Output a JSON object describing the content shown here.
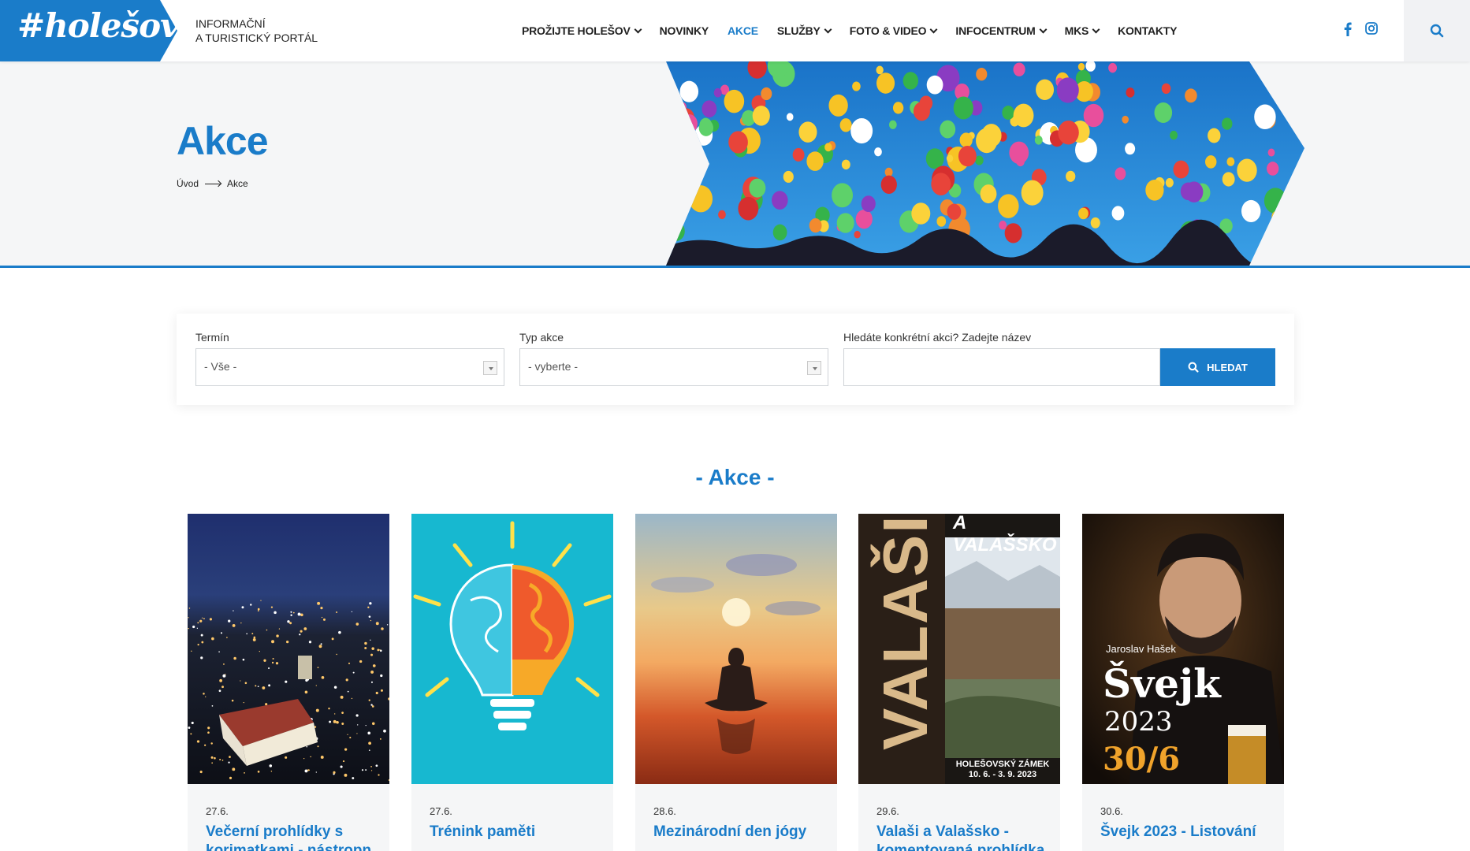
{
  "header": {
    "logo_text": "#holešov",
    "portal_line1": "INFORMAČNÍ",
    "portal_line2": "A TURISTICKÝ PORTÁL",
    "nav": [
      {
        "label": "PROŽIJTE HOLEŠOV",
        "dropdown": true,
        "active": false
      },
      {
        "label": "NOVINKY",
        "dropdown": false,
        "active": false
      },
      {
        "label": "AKCE",
        "dropdown": false,
        "active": true
      },
      {
        "label": "SLUŽBY",
        "dropdown": true,
        "active": false
      },
      {
        "label": "FOTO & VIDEO",
        "dropdown": true,
        "active": false
      },
      {
        "label": "INFOCENTRUM",
        "dropdown": true,
        "active": false
      },
      {
        "label": "MKS",
        "dropdown": true,
        "active": false
      },
      {
        "label": "KONTAKTY",
        "dropdown": false,
        "active": false
      }
    ],
    "social_icons": [
      "facebook-icon",
      "instagram-icon"
    ]
  },
  "hero": {
    "title": "Akce",
    "breadcrumb": [
      "Úvod",
      "Akce"
    ]
  },
  "filter": {
    "term_label": "Termín",
    "term_value": "- Vše -",
    "type_label": "Typ akce",
    "type_value": "- vyberte -",
    "search_label": "Hledáte konkrétní akci? Zadejte název",
    "search_value": "",
    "button_label": "HLEDAT"
  },
  "events_section": {
    "title": "- Akce -",
    "cards": [
      {
        "date": "27.6.",
        "title": "Večerní prohlídky s korimatkami - nástropn"
      },
      {
        "date": "27.6.",
        "title": "Trénink paměti"
      },
      {
        "date": "28.6.",
        "title": "Mezinárodní den jógy"
      },
      {
        "date": "29.6.",
        "title": "Valaši a Valašsko - komentovaná prohlídka"
      },
      {
        "date": "30.6.",
        "title": "Švejk 2023 - Listování"
      }
    ],
    "poster_texts": {
      "valassko_header": "A VALAŠSKO",
      "valassko_vertical": "VALAŠI",
      "valassko_footer1": "HOLEŠOVSKÝ ZÁMEK",
      "valassko_footer2": "10. 6. - 3. 9. 2023",
      "svejk_author": "Jaroslav Hašek",
      "svejk_title": "Švejk",
      "svejk_year": "2023",
      "svejk_date": "30/6"
    }
  },
  "colors": {
    "accent": "#1a7cc9",
    "hero_bg": "#f5f6f7"
  }
}
